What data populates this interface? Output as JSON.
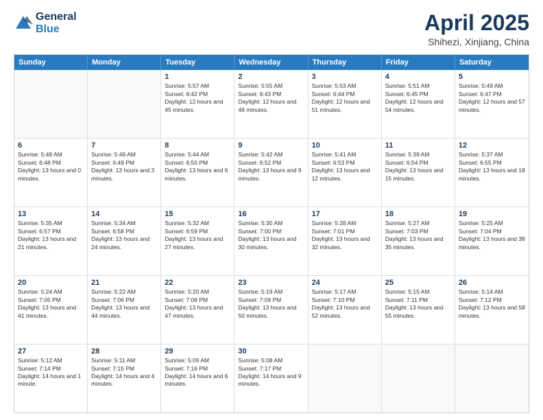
{
  "header": {
    "logo": {
      "line1": "General",
      "line2": "Blue"
    },
    "title": "April 2025",
    "subtitle": "Shihezi, Xinjiang, China"
  },
  "weekdays": [
    "Sunday",
    "Monday",
    "Tuesday",
    "Wednesday",
    "Thursday",
    "Friday",
    "Saturday"
  ],
  "weeks": [
    [
      {
        "day": "",
        "empty": true
      },
      {
        "day": "",
        "empty": true
      },
      {
        "day": "1",
        "sunrise": "5:57 AM",
        "sunset": "6:42 PM",
        "daylight": "12 hours and 45 minutes."
      },
      {
        "day": "2",
        "sunrise": "5:55 AM",
        "sunset": "6:43 PM",
        "daylight": "12 hours and 48 minutes."
      },
      {
        "day": "3",
        "sunrise": "5:53 AM",
        "sunset": "6:44 PM",
        "daylight": "12 hours and 51 minutes."
      },
      {
        "day": "4",
        "sunrise": "5:51 AM",
        "sunset": "6:45 PM",
        "daylight": "12 hours and 54 minutes."
      },
      {
        "day": "5",
        "sunrise": "5:49 AM",
        "sunset": "6:47 PM",
        "daylight": "12 hours and 57 minutes."
      }
    ],
    [
      {
        "day": "6",
        "sunrise": "5:48 AM",
        "sunset": "6:48 PM",
        "daylight": "13 hours and 0 minutes."
      },
      {
        "day": "7",
        "sunrise": "5:46 AM",
        "sunset": "6:49 PM",
        "daylight": "13 hours and 3 minutes."
      },
      {
        "day": "8",
        "sunrise": "5:44 AM",
        "sunset": "6:50 PM",
        "daylight": "13 hours and 6 minutes."
      },
      {
        "day": "9",
        "sunrise": "5:42 AM",
        "sunset": "6:52 PM",
        "daylight": "13 hours and 9 minutes."
      },
      {
        "day": "10",
        "sunrise": "5:41 AM",
        "sunset": "6:53 PM",
        "daylight": "13 hours and 12 minutes."
      },
      {
        "day": "11",
        "sunrise": "5:39 AM",
        "sunset": "6:54 PM",
        "daylight": "13 hours and 15 minutes."
      },
      {
        "day": "12",
        "sunrise": "5:37 AM",
        "sunset": "6:55 PM",
        "daylight": "13 hours and 18 minutes."
      }
    ],
    [
      {
        "day": "13",
        "sunrise": "5:35 AM",
        "sunset": "6:57 PM",
        "daylight": "13 hours and 21 minutes."
      },
      {
        "day": "14",
        "sunrise": "5:34 AM",
        "sunset": "6:58 PM",
        "daylight": "13 hours and 24 minutes."
      },
      {
        "day": "15",
        "sunrise": "5:32 AM",
        "sunset": "6:59 PM",
        "daylight": "13 hours and 27 minutes."
      },
      {
        "day": "16",
        "sunrise": "5:30 AM",
        "sunset": "7:00 PM",
        "daylight": "13 hours and 30 minutes."
      },
      {
        "day": "17",
        "sunrise": "5:28 AM",
        "sunset": "7:01 PM",
        "daylight": "13 hours and 32 minutes."
      },
      {
        "day": "18",
        "sunrise": "5:27 AM",
        "sunset": "7:03 PM",
        "daylight": "13 hours and 35 minutes."
      },
      {
        "day": "19",
        "sunrise": "5:25 AM",
        "sunset": "7:04 PM",
        "daylight": "13 hours and 38 minutes."
      }
    ],
    [
      {
        "day": "20",
        "sunrise": "5:24 AM",
        "sunset": "7:05 PM",
        "daylight": "13 hours and 41 minutes."
      },
      {
        "day": "21",
        "sunrise": "5:22 AM",
        "sunset": "7:06 PM",
        "daylight": "13 hours and 44 minutes."
      },
      {
        "day": "22",
        "sunrise": "5:20 AM",
        "sunset": "7:08 PM",
        "daylight": "13 hours and 47 minutes."
      },
      {
        "day": "23",
        "sunrise": "5:19 AM",
        "sunset": "7:09 PM",
        "daylight": "13 hours and 50 minutes."
      },
      {
        "day": "24",
        "sunrise": "5:17 AM",
        "sunset": "7:10 PM",
        "daylight": "13 hours and 52 minutes."
      },
      {
        "day": "25",
        "sunrise": "5:15 AM",
        "sunset": "7:11 PM",
        "daylight": "13 hours and 55 minutes."
      },
      {
        "day": "26",
        "sunrise": "5:14 AM",
        "sunset": "7:12 PM",
        "daylight": "13 hours and 58 minutes."
      }
    ],
    [
      {
        "day": "27",
        "sunrise": "5:12 AM",
        "sunset": "7:14 PM",
        "daylight": "14 hours and 1 minute."
      },
      {
        "day": "28",
        "sunrise": "5:11 AM",
        "sunset": "7:15 PM",
        "daylight": "14 hours and 4 minutes."
      },
      {
        "day": "29",
        "sunrise": "5:09 AM",
        "sunset": "7:16 PM",
        "daylight": "14 hours and 6 minutes."
      },
      {
        "day": "30",
        "sunrise": "5:08 AM",
        "sunset": "7:17 PM",
        "daylight": "14 hours and 9 minutes."
      },
      {
        "day": "",
        "empty": true
      },
      {
        "day": "",
        "empty": true
      },
      {
        "day": "",
        "empty": true
      }
    ]
  ],
  "labels": {
    "sunrise": "Sunrise:",
    "sunset": "Sunset:",
    "daylight": "Daylight:"
  }
}
